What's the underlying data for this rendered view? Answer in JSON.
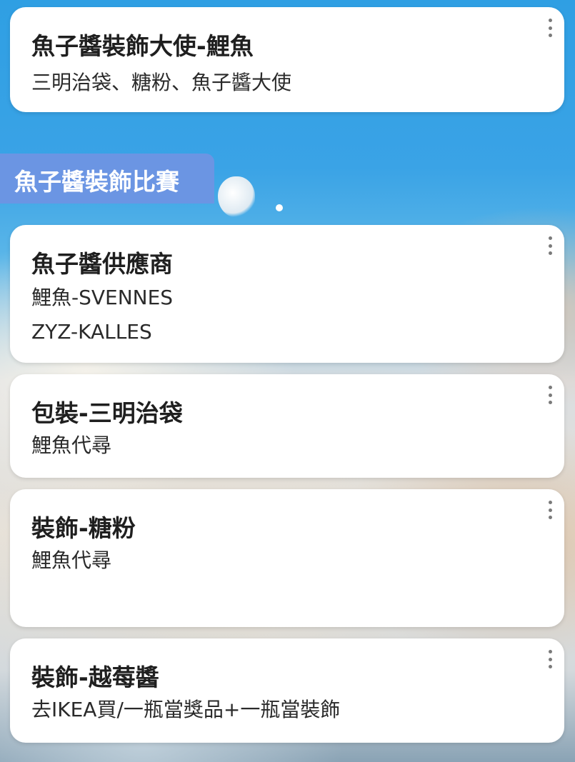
{
  "cards_top": [
    {
      "title": "魚子醬裝飾大使-鯉魚",
      "lines": [
        "三明治袋、糖粉、魚子醬大使"
      ]
    }
  ],
  "section": {
    "title": "魚子醬裝飾比賽"
  },
  "cards": [
    {
      "title": "魚子醬供應商",
      "lines": [
        "鯉魚-SVENNES",
        "ZYZ-KALLES"
      ]
    },
    {
      "title": "包裝-三明治袋",
      "lines": [
        "鯉魚代尋"
      ]
    },
    {
      "title": "裝飾-糖粉",
      "lines": [
        "鯉魚代尋"
      ]
    },
    {
      "title": "裝飾-越莓醬",
      "lines": [
        "去IKEA買/一瓶當獎品+一瓶當裝飾"
      ]
    }
  ],
  "icons": {
    "card_menu": "more-vertical-icon"
  },
  "colors": {
    "section_header_bg": "#6b95e3",
    "card_bg": "#ffffff",
    "title_text": "#1f1f1f"
  }
}
